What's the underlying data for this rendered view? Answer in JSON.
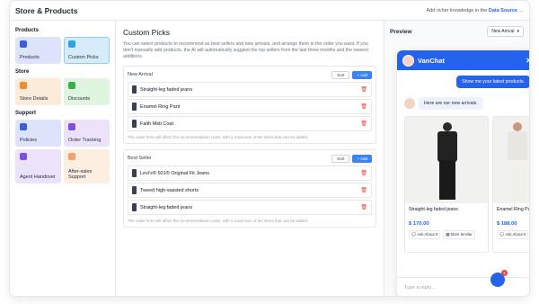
{
  "topbar": {
    "title": "Store & Products",
    "hint_prefix": "Add richer knowledge in the",
    "hint_link": "Data Source",
    "hint_arrow": "→"
  },
  "sidebar": {
    "sections": [
      {
        "label": "Products"
      },
      {
        "label": "Store"
      },
      {
        "label": "Support"
      }
    ],
    "tiles": {
      "products": "Products",
      "custom_picks": "Custom Picks",
      "store_details": "Store Details",
      "discounts": "Discounts",
      "policies": "Policies",
      "order_tracking": "Order Tracking",
      "agent_handover": "Agent Handover",
      "aftersales": "After-sales Support"
    }
  },
  "main": {
    "title": "Custom Picks",
    "description": "You can select products to recommend as best sellers and new arrivals, and arrange them in the order you want. If you don't manually add products, the AI will automatically suggest the top sellers from the last three months and the newest additions.",
    "sort_label": "Sort",
    "add_label": "+ Add",
    "note": "The order here will affect the recommendation order, with a maximum of ten items that can be added.",
    "new_arrival": {
      "label": "New Arrival",
      "items": [
        "Straight-leg faded jeans",
        "Enamel Ring Pant",
        "Faith Midi Coat"
      ]
    },
    "best_seller": {
      "label": "Best Seller",
      "items": [
        "Levi's® 501® Original Fit Jeans",
        "Tweed high-waisted shorts",
        "Straight-leg faded jeans"
      ]
    }
  },
  "preview": {
    "label": "Preview",
    "select_value": "New Arrival",
    "chat": {
      "name": "VanChat",
      "user_msg": "Show me your latest products.",
      "bot_msg": "Here are our new arrivals.",
      "products": [
        {
          "name": "Straight-leg faded jeans",
          "price": "$ 170.00"
        },
        {
          "name": "Enamel Ring Pant",
          "price": "$ 188.00"
        }
      ],
      "ask_label": "Ask About It",
      "more_label": "More Similar",
      "input_placeholder": "Type a reply..."
    },
    "badge": "1"
  },
  "colors": {
    "accent": "#2563eb",
    "danger": "#ef4444"
  }
}
